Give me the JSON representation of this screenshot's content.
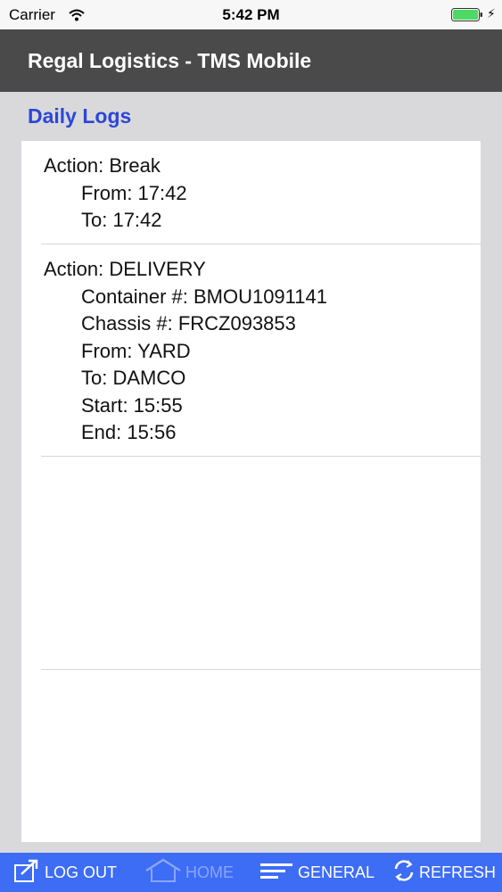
{
  "status_bar": {
    "carrier": "Carrier",
    "time": "5:42 PM",
    "icons": [
      "wifi-icon",
      "battery-icon",
      "charging-bolt-icon"
    ]
  },
  "header": {
    "title": "Regal Logistics - TMS Mobile"
  },
  "section": {
    "title": "Daily Logs"
  },
  "logs": [
    {
      "action": "Action: Break",
      "details": [
        "From: 17:42",
        "To: 17:42"
      ]
    },
    {
      "action": "Action: DELIVERY",
      "details": [
        "Container #: BMOU1091141",
        "Chassis #: FRCZ093853",
        "From: YARD",
        "To: DAMCO",
        "Start: 15:55",
        "End: 15:56"
      ]
    }
  ],
  "toolbar": {
    "logout_label": "LOG OUT",
    "home_label": "HOME",
    "general_label": "GENERAL",
    "refresh_label": "REFRESH"
  },
  "colors": {
    "header_bg": "#4a4a4a",
    "section_title": "#2b47d8",
    "toolbar_bg": "#3d6cf5",
    "battery": "#4cd964"
  }
}
